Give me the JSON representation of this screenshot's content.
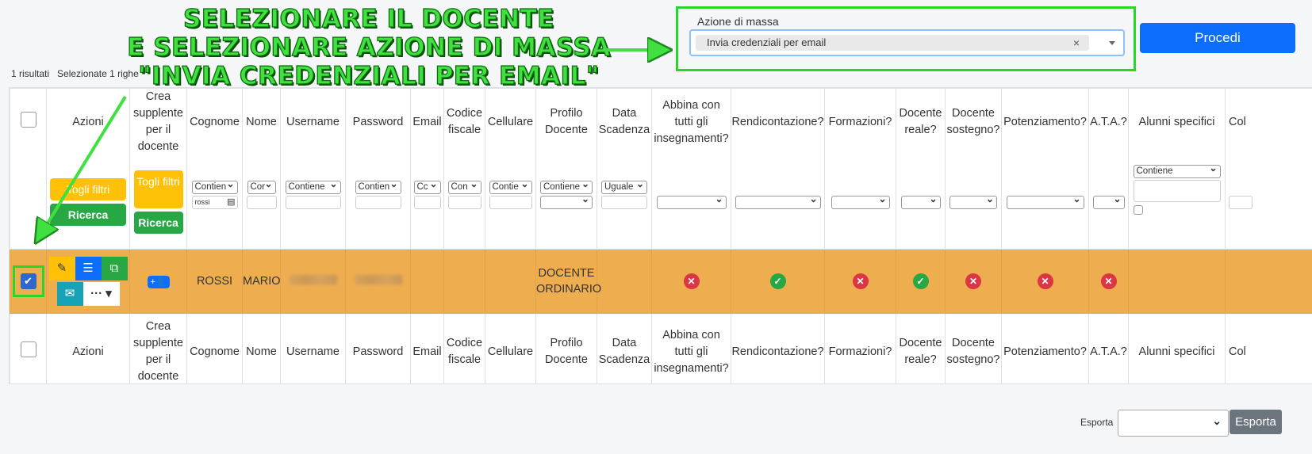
{
  "annotation": {
    "lines": [
      "SELEZIONARE IL DOCENTE",
      "E SELEZIONARE AZIONE DI MASSA",
      "\"INVIA CREDENZIALI PER EMAIL\""
    ],
    "color": "#3fe03f"
  },
  "results": {
    "count_text": "1 risultati",
    "selected_text": "Selezionate 1 righe"
  },
  "mass_action": {
    "label": "Azione di massa",
    "value": "Invia credenziali per email",
    "clear": "×"
  },
  "procedi_label": "Procedi",
  "columns": [
    "Azioni",
    "Crea supplente per il docente",
    "Cognome",
    "Nome",
    "Username",
    "Password",
    "Email",
    "Codice fiscale",
    "Cellulare",
    "Profilo Docente",
    "Data Scadenza",
    "Abbina con tutti gli insegnamenti?",
    "Rendicontazione?",
    "Formazioni?",
    "Docente reale?",
    "Docente sostegno?",
    "Potenziamento?",
    "A.T.A.?",
    "Alunni specifici",
    "Col"
  ],
  "filters": {
    "togli_filtri": "Togli filtri",
    "ricerca": "Ricerca",
    "cognome_op": "Contien",
    "cognome_value": "rossi",
    "nome_op": "Cor",
    "username_op": "Contiene",
    "password_op": "Contien",
    "email_op": "Cc",
    "cf_op": "Con",
    "cell_op": "Contie",
    "profilo_op": "Contiene",
    "scadenza_op": "Uguale",
    "alunni_op": "Contiene"
  },
  "row": {
    "cognome": "ROSSI",
    "nome": "MARIO",
    "profilo": "DOCENTE ORDINARIO",
    "abbina": "no",
    "rendicontazione": "yes",
    "formazioni": "no",
    "reale": "yes",
    "sostegno": "no",
    "potenziamento": "no",
    "ata": "no",
    "selected": true
  },
  "colors": {
    "row_bg": "#eeae50",
    "primary": "#0d6efd",
    "yes": "#28a745",
    "no": "#dc3545"
  },
  "export": {
    "label": "Esporta",
    "button": "Esporta"
  }
}
